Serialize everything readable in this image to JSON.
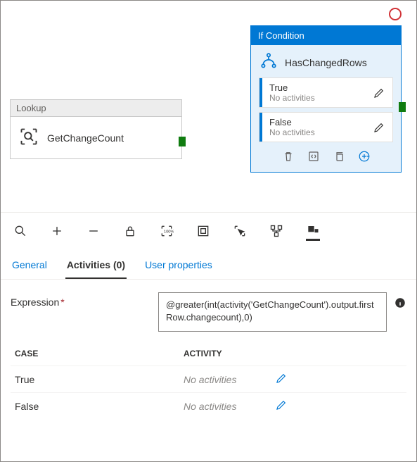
{
  "canvas": {
    "lookup": {
      "header": "Lookup",
      "title": "GetChangeCount"
    },
    "condition": {
      "header": "If Condition",
      "title": "HasChangedRows",
      "branches": [
        {
          "name": "True",
          "sub": "No activities"
        },
        {
          "name": "False",
          "sub": "No activities"
        }
      ]
    }
  },
  "tabs": {
    "general": "General",
    "activities": "Activities (0)",
    "user_props": "User properties"
  },
  "props": {
    "expression_label": "Expression",
    "expression_value": "@greater(int(activity('GetChangeCount').output.firstRow.changecount),0)"
  },
  "case_table": {
    "col1": "CASE",
    "col2": "ACTIVITY",
    "rows": [
      {
        "case": "True",
        "activity": "No activities"
      },
      {
        "case": "False",
        "activity": "No activities"
      }
    ]
  }
}
